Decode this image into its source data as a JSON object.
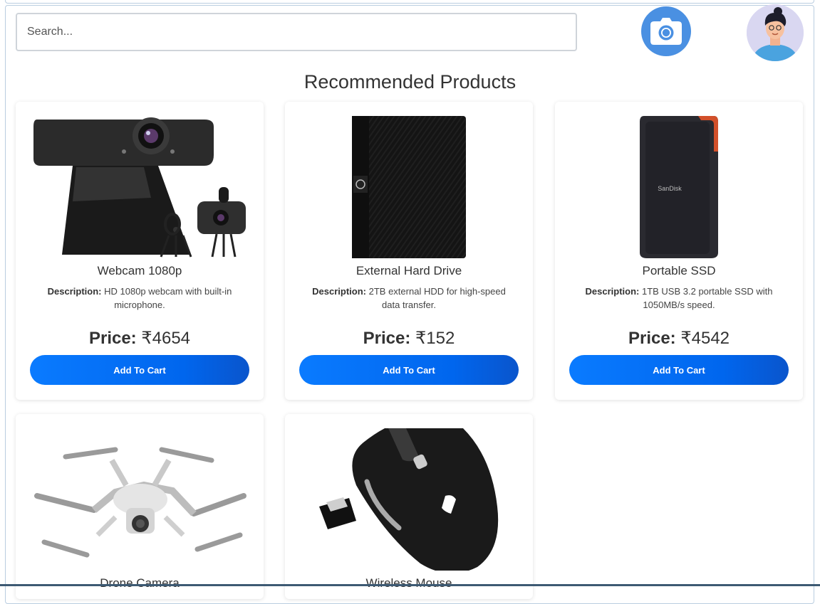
{
  "search": {
    "placeholder": "Search..."
  },
  "header": {
    "camera_icon": "camera-icon",
    "avatar_icon": "user-avatar-icon"
  },
  "section_title": "Recommended Products",
  "labels": {
    "description": "Description:",
    "price": "Price:",
    "currency": "₹",
    "add_to_cart": "Add To Cart"
  },
  "colors": {
    "accent": "#0a7bff",
    "camera_bg": "#4a90e2",
    "avatar_bg": "#d9d7f1"
  },
  "products": [
    {
      "name": "Webcam 1080p",
      "description": "HD 1080p webcam with built-in microphone.",
      "price": "4654",
      "image_icon": "webcam-image"
    },
    {
      "name": "External Hard Drive",
      "description": "2TB external HDD for high-speed data transfer.",
      "price": "152",
      "image_icon": "hard-drive-image"
    },
    {
      "name": "Portable SSD",
      "description": "1TB USB 3.2 portable SSD with 1050MB/s speed.",
      "price": "4542",
      "image_icon": "ssd-image"
    },
    {
      "name": "Drone Camera",
      "image_icon": "drone-image"
    },
    {
      "name": "Wireless Mouse",
      "image_icon": "mouse-image"
    }
  ]
}
